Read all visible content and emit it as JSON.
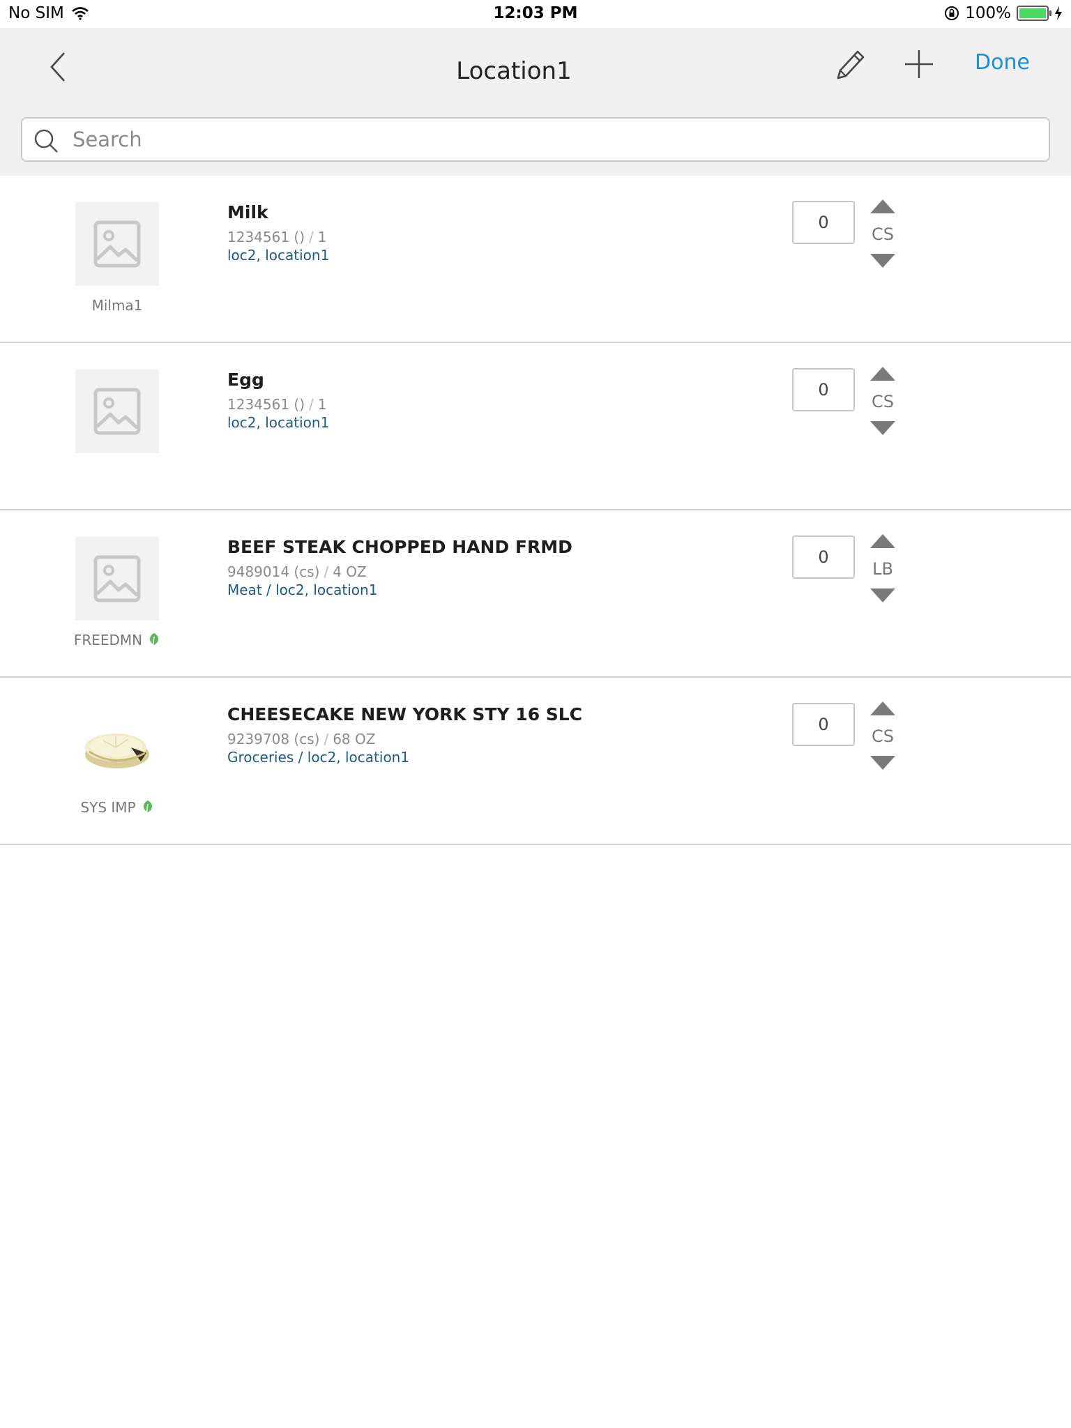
{
  "status_bar": {
    "carrier": "No SIM",
    "time": "12:03 PM",
    "battery": "100%"
  },
  "nav": {
    "title": "Location1",
    "done_label": "Done"
  },
  "search": {
    "placeholder": "Search"
  },
  "items": [
    {
      "name": "Milk",
      "code": "1234561 ()",
      "pack": "1",
      "locations": "loc2, location1",
      "vendor": "Milma1",
      "quantity": "0",
      "unit": "CS"
    },
    {
      "name": "Egg",
      "code": "1234561 ()",
      "pack": "1",
      "locations": "loc2, location1",
      "vendor": "",
      "quantity": "0",
      "unit": "CS"
    },
    {
      "name": "BEEF STEAK CHOPPED HAND FRMD",
      "code": "9489014 (cs)",
      "pack": "4 OZ",
      "locations": "Meat / loc2, location1",
      "vendor": "FREEDMN",
      "quantity": "0",
      "unit": "LB"
    },
    {
      "name": "CHEESECAKE NEW YORK STY 16 SLC",
      "code": "9239708 (cs)",
      "pack": "68 OZ",
      "locations": "Groceries / loc2, location1",
      "vendor": "SYS IMP",
      "quantity": "0",
      "unit": "CS"
    }
  ],
  "colors": {
    "accent": "#1a8fd6",
    "location_text": "#1a5a8a",
    "leaf": "#5cb85c",
    "battery": "#4cd964"
  }
}
